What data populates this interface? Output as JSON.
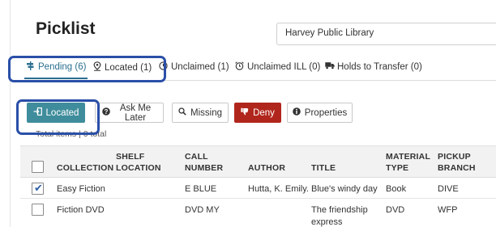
{
  "page": {
    "title": "Picklist"
  },
  "library_select": {
    "value": "Harvey Public Library"
  },
  "tabs": [
    {
      "label": "Pending (6)",
      "icon": "signpost-icon",
      "active": true
    },
    {
      "label": "Located (1)",
      "icon": "map-marker-icon",
      "active": false
    },
    {
      "label": "Unclaimed (1)",
      "icon": "clock-icon",
      "active": false
    },
    {
      "label": "Unclaimed ILL (0)",
      "icon": "alarm-clock-icon",
      "active": false
    },
    {
      "label": "Holds to Transfer (0)",
      "icon": "truck-icon",
      "active": false
    }
  ],
  "toolbar": {
    "located_label": "Located",
    "ask_later_label": "Ask Me Later",
    "missing_label": "Missing",
    "deny_label": "Deny",
    "properties_label": "Properties"
  },
  "total_text": "Total items | 0 total",
  "table": {
    "headers": {
      "collection": "COLLECTION",
      "shelf_line1": "SHELF",
      "shelf_line2": "LOCATION",
      "call_line1": "CALL",
      "call_line2": "NUMBER",
      "author": "AUTHOR",
      "title": "TITLE",
      "material_line1": "MATERIAL",
      "material_line2": "TYPE",
      "pickup_line1": "PICKUP",
      "pickup_line2": "BRANCH"
    },
    "rows": [
      {
        "checked": true,
        "collection": "Easy Fiction",
        "shelf": "",
        "call": "E BLUE",
        "author": "Hutta, K. Emily.",
        "title_line1": "Blue's windy day",
        "title_line2": "",
        "material": "Book",
        "pickup": "DIVE"
      },
      {
        "checked": false,
        "collection": "Fiction DVD",
        "shelf": "",
        "call": "DVD MY",
        "author": "",
        "title_line1": "The friendship",
        "title_line2": "express",
        "material": "DVD",
        "pickup": "WFP"
      }
    ]
  },
  "colors": {
    "accent": "#3f8d9c",
    "deny": "#b1261c",
    "highlight": "#2a4fa8",
    "active_tab": "#2b6f8f"
  }
}
